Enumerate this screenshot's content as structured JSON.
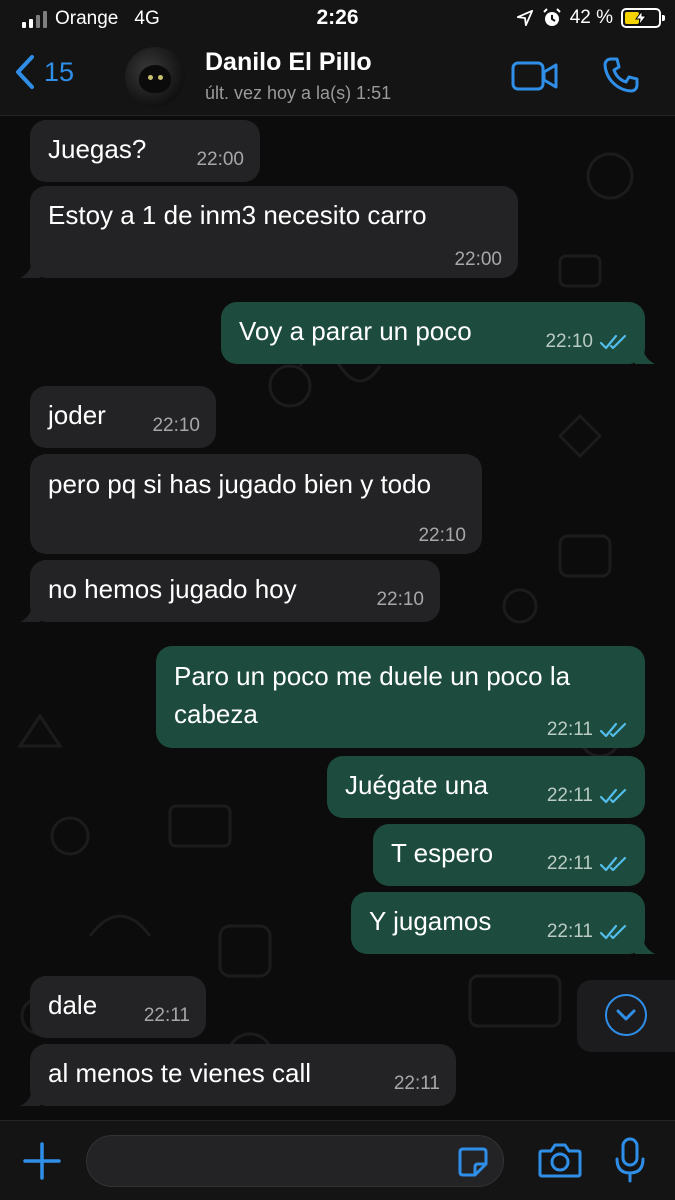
{
  "status_bar": {
    "carrier": "Orange",
    "network": "4G",
    "time": "2:26",
    "battery": "42 %"
  },
  "header": {
    "back_count": "15",
    "contact_name": "Danilo El Pillo",
    "last_seen": "últ. vez hoy a la(s) 1:51",
    "icons": [
      "chevron-left-icon",
      "video-call-icon",
      "phone-icon"
    ]
  },
  "messages": [
    {
      "dir": "in",
      "text": "Juegas?",
      "time": "22:00"
    },
    {
      "dir": "in",
      "text": "Estoy a 1 de inm3 necesito carro",
      "time": "22:00"
    },
    {
      "dir": "out",
      "text": "Voy a parar un poco",
      "time": "22:10"
    },
    {
      "dir": "in",
      "text": "joder",
      "time": "22:10"
    },
    {
      "dir": "in",
      "text": "pero pq si has jugado bien y todo",
      "time": "22:10"
    },
    {
      "dir": "in",
      "text": "no hemos jugado hoy",
      "time": "22:10"
    },
    {
      "dir": "out",
      "text": "Paro un poco me duele un poco la cabeza",
      "time": "22:11"
    },
    {
      "dir": "out",
      "text": "Juégate una",
      "time": "22:11"
    },
    {
      "dir": "out",
      "text": "T espero",
      "time": "22:11"
    },
    {
      "dir": "out",
      "text": "Y jugamos",
      "time": "22:11"
    },
    {
      "dir": "in",
      "text": "dale",
      "time": "22:11"
    },
    {
      "dir": "in",
      "text": "al menos te vienes call",
      "time": "22:11"
    }
  ],
  "input_bar": {
    "message_value": "",
    "icons": [
      "plus-icon",
      "sticker-icon",
      "camera-icon",
      "microphone-icon"
    ]
  },
  "colors": {
    "accent": "#2f8fe8",
    "incoming_bubble": "#232325",
    "outgoing_bubble": "#1d4b3d",
    "read_ticks": "#53bdeb"
  }
}
